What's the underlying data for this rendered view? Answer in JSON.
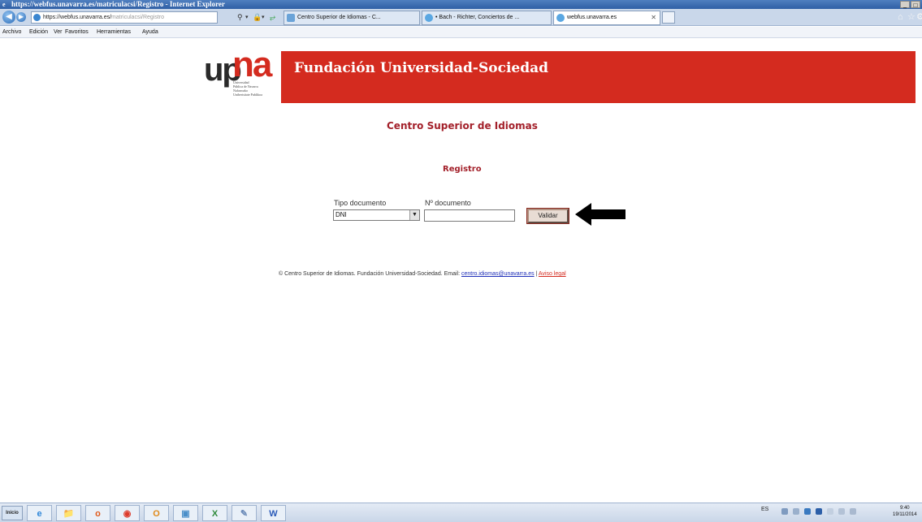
{
  "window": {
    "title": "https://webfus.unavarra.es/matriculacsi/Registro - Internet Explorer",
    "min": "_",
    "restore": "□"
  },
  "nav": {
    "back_icon": "arrow-left-icon",
    "address_host": "https://webfus.unavarra.es/",
    "address_path": "matriculacsi/Registro",
    "tabs": [
      {
        "label": "Centro Superior de Idiomas - C..."
      },
      {
        "label": "• Bach - Richter, Conciertos de ..."
      },
      {
        "label": "webfus.unavarra.es"
      }
    ]
  },
  "menu": {
    "items": [
      "Archivo",
      "Edición",
      "Ver",
      "Favoritos",
      "Herramientas",
      "Ayuda"
    ]
  },
  "header": {
    "logo_up": "up",
    "logo_na": "na",
    "logo_small_1": "Universidad",
    "logo_small_2": "Pública de Navarra",
    "logo_small_3": "Nafarroako",
    "logo_small_4": "Unibertsitate Publikoa",
    "title": "Fundación Universidad-Sociedad"
  },
  "page": {
    "heading": "Centro Superior de Idiomas",
    "subheading": "Registro"
  },
  "form": {
    "tipo_label": "Tipo documento",
    "tipo_value": "DNI",
    "num_label": "Nº documento",
    "num_value": "",
    "validar_label": "Validar"
  },
  "footer": {
    "text": "© Centro Superior de Idiomas. Fundación Universidad-Sociedad. Email: ",
    "email": "centro.idiomas@unavarra.es",
    "separator": " | ",
    "aviso": "Aviso legal"
  },
  "taskbar": {
    "start": "Inicio",
    "lang": "ES",
    "time": "9:40",
    "date": "19/11/2014"
  }
}
